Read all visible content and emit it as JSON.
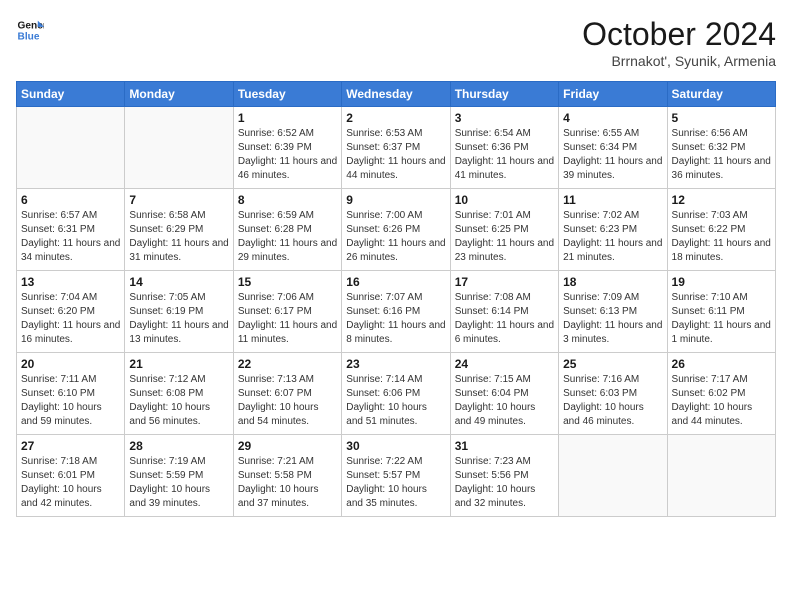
{
  "header": {
    "logo_line1": "General",
    "logo_line2": "Blue",
    "month_title": "October 2024",
    "location": "Brrnakot', Syunik, Armenia"
  },
  "weekdays": [
    "Sunday",
    "Monday",
    "Tuesday",
    "Wednesday",
    "Thursday",
    "Friday",
    "Saturday"
  ],
  "weeks": [
    [
      {
        "day": "",
        "sunrise": "",
        "sunset": "",
        "daylight": ""
      },
      {
        "day": "",
        "sunrise": "",
        "sunset": "",
        "daylight": ""
      },
      {
        "day": "1",
        "sunrise": "Sunrise: 6:52 AM",
        "sunset": "Sunset: 6:39 PM",
        "daylight": "Daylight: 11 hours and 46 minutes."
      },
      {
        "day": "2",
        "sunrise": "Sunrise: 6:53 AM",
        "sunset": "Sunset: 6:37 PM",
        "daylight": "Daylight: 11 hours and 44 minutes."
      },
      {
        "day": "3",
        "sunrise": "Sunrise: 6:54 AM",
        "sunset": "Sunset: 6:36 PM",
        "daylight": "Daylight: 11 hours and 41 minutes."
      },
      {
        "day": "4",
        "sunrise": "Sunrise: 6:55 AM",
        "sunset": "Sunset: 6:34 PM",
        "daylight": "Daylight: 11 hours and 39 minutes."
      },
      {
        "day": "5",
        "sunrise": "Sunrise: 6:56 AM",
        "sunset": "Sunset: 6:32 PM",
        "daylight": "Daylight: 11 hours and 36 minutes."
      }
    ],
    [
      {
        "day": "6",
        "sunrise": "Sunrise: 6:57 AM",
        "sunset": "Sunset: 6:31 PM",
        "daylight": "Daylight: 11 hours and 34 minutes."
      },
      {
        "day": "7",
        "sunrise": "Sunrise: 6:58 AM",
        "sunset": "Sunset: 6:29 PM",
        "daylight": "Daylight: 11 hours and 31 minutes."
      },
      {
        "day": "8",
        "sunrise": "Sunrise: 6:59 AM",
        "sunset": "Sunset: 6:28 PM",
        "daylight": "Daylight: 11 hours and 29 minutes."
      },
      {
        "day": "9",
        "sunrise": "Sunrise: 7:00 AM",
        "sunset": "Sunset: 6:26 PM",
        "daylight": "Daylight: 11 hours and 26 minutes."
      },
      {
        "day": "10",
        "sunrise": "Sunrise: 7:01 AM",
        "sunset": "Sunset: 6:25 PM",
        "daylight": "Daylight: 11 hours and 23 minutes."
      },
      {
        "day": "11",
        "sunrise": "Sunrise: 7:02 AM",
        "sunset": "Sunset: 6:23 PM",
        "daylight": "Daylight: 11 hours and 21 minutes."
      },
      {
        "day": "12",
        "sunrise": "Sunrise: 7:03 AM",
        "sunset": "Sunset: 6:22 PM",
        "daylight": "Daylight: 11 hours and 18 minutes."
      }
    ],
    [
      {
        "day": "13",
        "sunrise": "Sunrise: 7:04 AM",
        "sunset": "Sunset: 6:20 PM",
        "daylight": "Daylight: 11 hours and 16 minutes."
      },
      {
        "day": "14",
        "sunrise": "Sunrise: 7:05 AM",
        "sunset": "Sunset: 6:19 PM",
        "daylight": "Daylight: 11 hours and 13 minutes."
      },
      {
        "day": "15",
        "sunrise": "Sunrise: 7:06 AM",
        "sunset": "Sunset: 6:17 PM",
        "daylight": "Daylight: 11 hours and 11 minutes."
      },
      {
        "day": "16",
        "sunrise": "Sunrise: 7:07 AM",
        "sunset": "Sunset: 6:16 PM",
        "daylight": "Daylight: 11 hours and 8 minutes."
      },
      {
        "day": "17",
        "sunrise": "Sunrise: 7:08 AM",
        "sunset": "Sunset: 6:14 PM",
        "daylight": "Daylight: 11 hours and 6 minutes."
      },
      {
        "day": "18",
        "sunrise": "Sunrise: 7:09 AM",
        "sunset": "Sunset: 6:13 PM",
        "daylight": "Daylight: 11 hours and 3 minutes."
      },
      {
        "day": "19",
        "sunrise": "Sunrise: 7:10 AM",
        "sunset": "Sunset: 6:11 PM",
        "daylight": "Daylight: 11 hours and 1 minute."
      }
    ],
    [
      {
        "day": "20",
        "sunrise": "Sunrise: 7:11 AM",
        "sunset": "Sunset: 6:10 PM",
        "daylight": "Daylight: 10 hours and 59 minutes."
      },
      {
        "day": "21",
        "sunrise": "Sunrise: 7:12 AM",
        "sunset": "Sunset: 6:08 PM",
        "daylight": "Daylight: 10 hours and 56 minutes."
      },
      {
        "day": "22",
        "sunrise": "Sunrise: 7:13 AM",
        "sunset": "Sunset: 6:07 PM",
        "daylight": "Daylight: 10 hours and 54 minutes."
      },
      {
        "day": "23",
        "sunrise": "Sunrise: 7:14 AM",
        "sunset": "Sunset: 6:06 PM",
        "daylight": "Daylight: 10 hours and 51 minutes."
      },
      {
        "day": "24",
        "sunrise": "Sunrise: 7:15 AM",
        "sunset": "Sunset: 6:04 PM",
        "daylight": "Daylight: 10 hours and 49 minutes."
      },
      {
        "day": "25",
        "sunrise": "Sunrise: 7:16 AM",
        "sunset": "Sunset: 6:03 PM",
        "daylight": "Daylight: 10 hours and 46 minutes."
      },
      {
        "day": "26",
        "sunrise": "Sunrise: 7:17 AM",
        "sunset": "Sunset: 6:02 PM",
        "daylight": "Daylight: 10 hours and 44 minutes."
      }
    ],
    [
      {
        "day": "27",
        "sunrise": "Sunrise: 7:18 AM",
        "sunset": "Sunset: 6:01 PM",
        "daylight": "Daylight: 10 hours and 42 minutes."
      },
      {
        "day": "28",
        "sunrise": "Sunrise: 7:19 AM",
        "sunset": "Sunset: 5:59 PM",
        "daylight": "Daylight: 10 hours and 39 minutes."
      },
      {
        "day": "29",
        "sunrise": "Sunrise: 7:21 AM",
        "sunset": "Sunset: 5:58 PM",
        "daylight": "Daylight: 10 hours and 37 minutes."
      },
      {
        "day": "30",
        "sunrise": "Sunrise: 7:22 AM",
        "sunset": "Sunset: 5:57 PM",
        "daylight": "Daylight: 10 hours and 35 minutes."
      },
      {
        "day": "31",
        "sunrise": "Sunrise: 7:23 AM",
        "sunset": "Sunset: 5:56 PM",
        "daylight": "Daylight: 10 hours and 32 minutes."
      },
      {
        "day": "",
        "sunrise": "",
        "sunset": "",
        "daylight": ""
      },
      {
        "day": "",
        "sunrise": "",
        "sunset": "",
        "daylight": ""
      }
    ]
  ]
}
